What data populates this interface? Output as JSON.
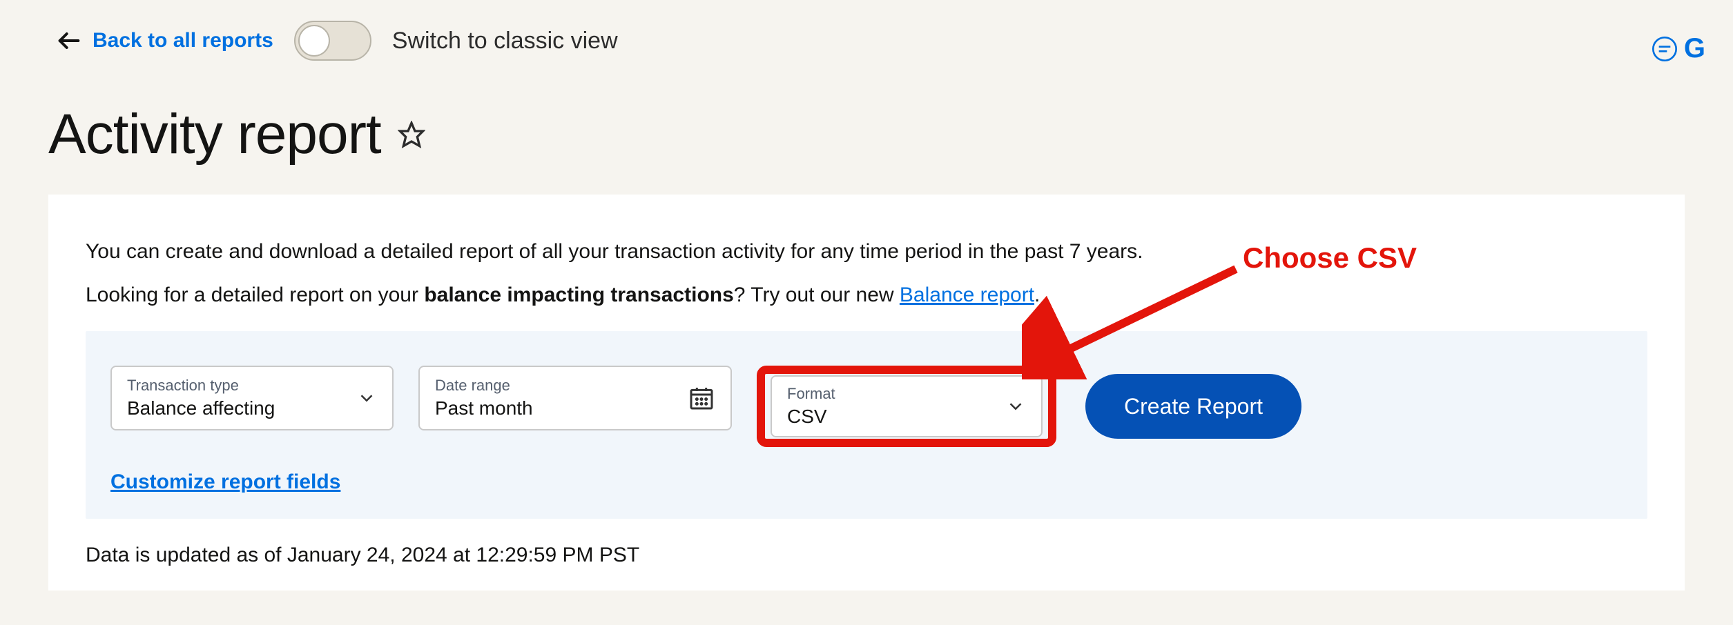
{
  "header": {
    "back_label": "Back to all reports",
    "toggle_label": "Switch to classic view",
    "help_initial": "G"
  },
  "title": "Activity report",
  "intro": {
    "line1": "You can create and download a detailed report of all your transaction activity for any time period in the past 7 years.",
    "line2_a": "Looking for a detailed report on your ",
    "line2_bold": "balance impacting transactions",
    "line2_b": "? Try out our new ",
    "line2_link": "Balance report",
    "line2_c": "."
  },
  "filters": {
    "transaction_type": {
      "label": "Transaction type",
      "value": "Balance affecting"
    },
    "date_range": {
      "label": "Date range",
      "value": "Past month"
    },
    "format": {
      "label": "Format",
      "value": "CSV"
    },
    "create_label": "Create Report",
    "customize_label": "Customize report fields"
  },
  "updated": "Data is updated as of January 24, 2024 at 12:29:59 PM PST",
  "annotation": {
    "text": "Choose CSV"
  }
}
